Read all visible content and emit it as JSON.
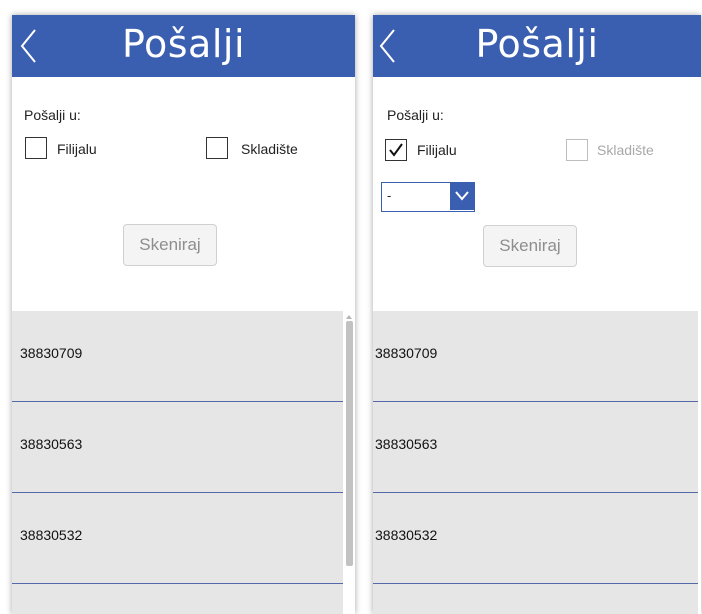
{
  "colors": {
    "header": "#3B5FB0",
    "header_text": "#ffffff",
    "list_bg": "#e6e6e6",
    "divider": "#5569a9"
  },
  "left": {
    "title": "Pošalji",
    "send_to_label": "Pošalji u:",
    "options": [
      {
        "label": "Filijalu",
        "checked": false
      },
      {
        "label": "Skladište",
        "checked": false
      }
    ],
    "scan_button": "Skeniraj",
    "items": [
      "38830709",
      "38830563",
      "38830532"
    ]
  },
  "right": {
    "title": "Pošalji",
    "send_to_label": "Pošalji u:",
    "options": [
      {
        "label": "Filijalu",
        "checked": true
      },
      {
        "label": "Skladište",
        "checked": false,
        "disabled": true
      }
    ],
    "dropdown_value": "-",
    "scan_button": "Skeniraj",
    "items": [
      "38830709",
      "38830563",
      "38830532"
    ]
  },
  "icons": {
    "back": "chevron-left-icon",
    "check": "checkmark-icon",
    "dropdown": "chevron-down-icon"
  }
}
